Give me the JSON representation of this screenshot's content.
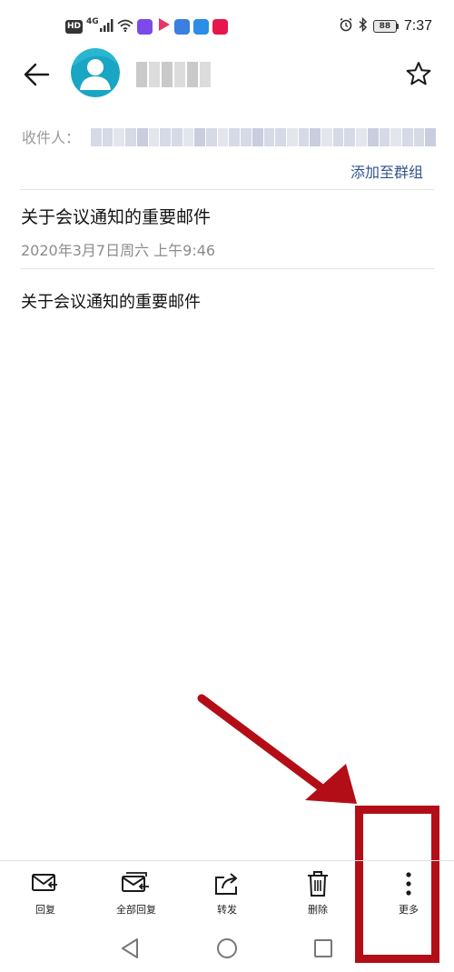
{
  "status_bar": {
    "hd": "HD",
    "network": "4G",
    "battery": "88",
    "time": "7:37",
    "icons": [
      "hd-badge",
      "signal-icon",
      "wifi-icon",
      "app-icons",
      "alarm-icon",
      "bluetooth-icon",
      "battery-icon"
    ]
  },
  "header": {
    "back_icon": "arrow-left-icon",
    "star_icon": "star-outline-icon"
  },
  "recipients": {
    "label": "收件人：",
    "add_to_group": "添加至群组"
  },
  "email": {
    "subject": "关于会议通知的重要邮件",
    "date": "2020年3月7日周六 上午9:46",
    "body": "关于会议通知的重要邮件"
  },
  "toolbar": {
    "items": [
      {
        "label": "回复",
        "icon": "reply-icon"
      },
      {
        "label": "全部回复",
        "icon": "reply-all-icon"
      },
      {
        "label": "转发",
        "icon": "forward-icon"
      },
      {
        "label": "删除",
        "icon": "trash-icon"
      },
      {
        "label": "更多",
        "icon": "more-vertical-icon"
      }
    ]
  },
  "nav_bar": {
    "icons": [
      "nav-back-icon",
      "nav-home-icon",
      "nav-recents-icon"
    ]
  },
  "colors": {
    "link": "#33538c",
    "annotation": "#b30e17",
    "avatar_bg": "#1aa5c4"
  }
}
